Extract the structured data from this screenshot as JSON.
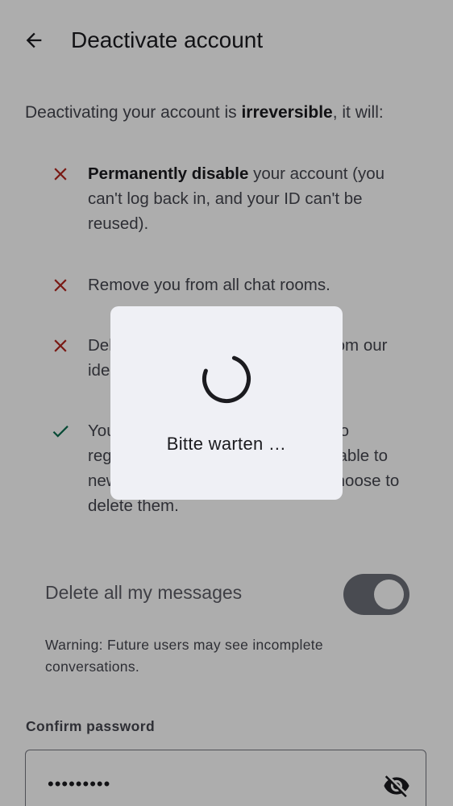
{
  "header": {
    "title": "Deactivate account"
  },
  "intro": {
    "prefix": "Deactivating your account is ",
    "bold": "irreversible",
    "suffix": ", it will:"
  },
  "items": [
    {
      "icon": "cross-icon",
      "color": "#b3261e",
      "bold": "Permanently disable",
      "text": " your account (you can't log back in, and your ID can't be reused)."
    },
    {
      "icon": "cross-icon",
      "color": "#b3261e",
      "bold": "",
      "text": "Remove you from all chat rooms."
    },
    {
      "icon": "cross-icon",
      "color": "#b3261e",
      "bold": "",
      "text": "Delete your account information from our identity server."
    },
    {
      "icon": "check-icon",
      "color": "#0a6d4f",
      "bold": "",
      "text": "Your messages will still be visible to registered users but won't be available to new or unregistered users if you choose to delete them."
    }
  ],
  "delete_messages": {
    "label": "Delete all my messages",
    "enabled": true
  },
  "warning": "Warning: Future users may see incomplete conversations.",
  "password": {
    "label": "Confirm password",
    "value": "•••••••••"
  },
  "dialog": {
    "text": "Bitte warten …"
  },
  "colors": {
    "danger": "#b3261e",
    "success": "#0a6d4f",
    "scrim": "rgba(0,0,0,0.32)",
    "dialog_bg": "#eff0f5"
  }
}
